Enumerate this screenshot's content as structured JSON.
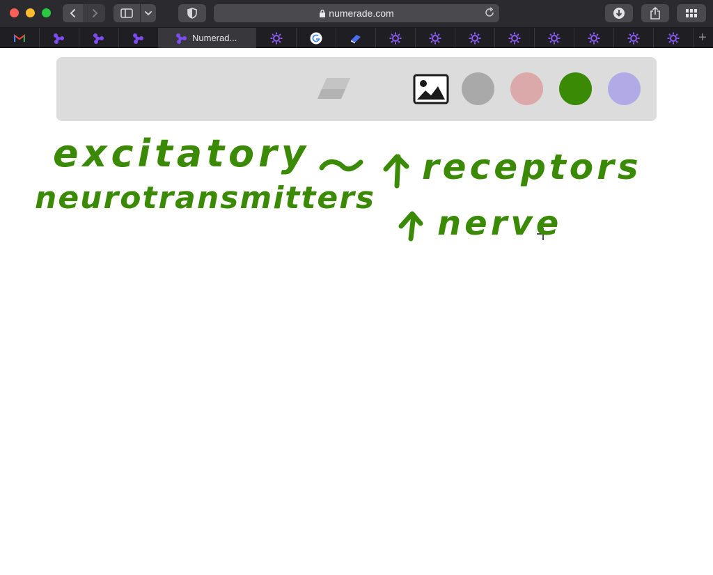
{
  "browser": {
    "url": "numerade.com",
    "tabs": [
      {
        "icon": "gmail-icon"
      },
      {
        "icon": "numerade-icon"
      },
      {
        "icon": "numerade-icon"
      },
      {
        "icon": "numerade-icon"
      },
      {
        "icon": "numerade-icon",
        "title": "Numerad...",
        "active": true
      },
      {
        "icon": "settings-sun-icon"
      },
      {
        "icon": "google-icon"
      },
      {
        "icon": "book-icon"
      },
      {
        "icon": "settings-sun-icon"
      },
      {
        "icon": "settings-sun-icon"
      },
      {
        "icon": "settings-sun-icon"
      },
      {
        "icon": "settings-sun-icon"
      },
      {
        "icon": "settings-sun-icon"
      },
      {
        "icon": "settings-sun-icon"
      },
      {
        "icon": "settings-sun-icon"
      },
      {
        "icon": "settings-sun-icon"
      }
    ],
    "new_tab_label": "+"
  },
  "toolbar": {
    "tools": [
      "eraser-icon",
      "image-icon"
    ],
    "colors": [
      "#a9a9a9",
      "#dba9a9",
      "#3a8a05",
      "#b2aae6"
    ],
    "selected_color": "#3a8a05"
  },
  "canvas": {
    "ink_color": "#3a8a05",
    "handwriting": {
      "line1": "excitatory",
      "line2": "neurotransmitters",
      "tilde": "~",
      "arrow1": "↑",
      "receptors": "receptors",
      "arrow2": "↑",
      "nerve": "nerve"
    }
  }
}
